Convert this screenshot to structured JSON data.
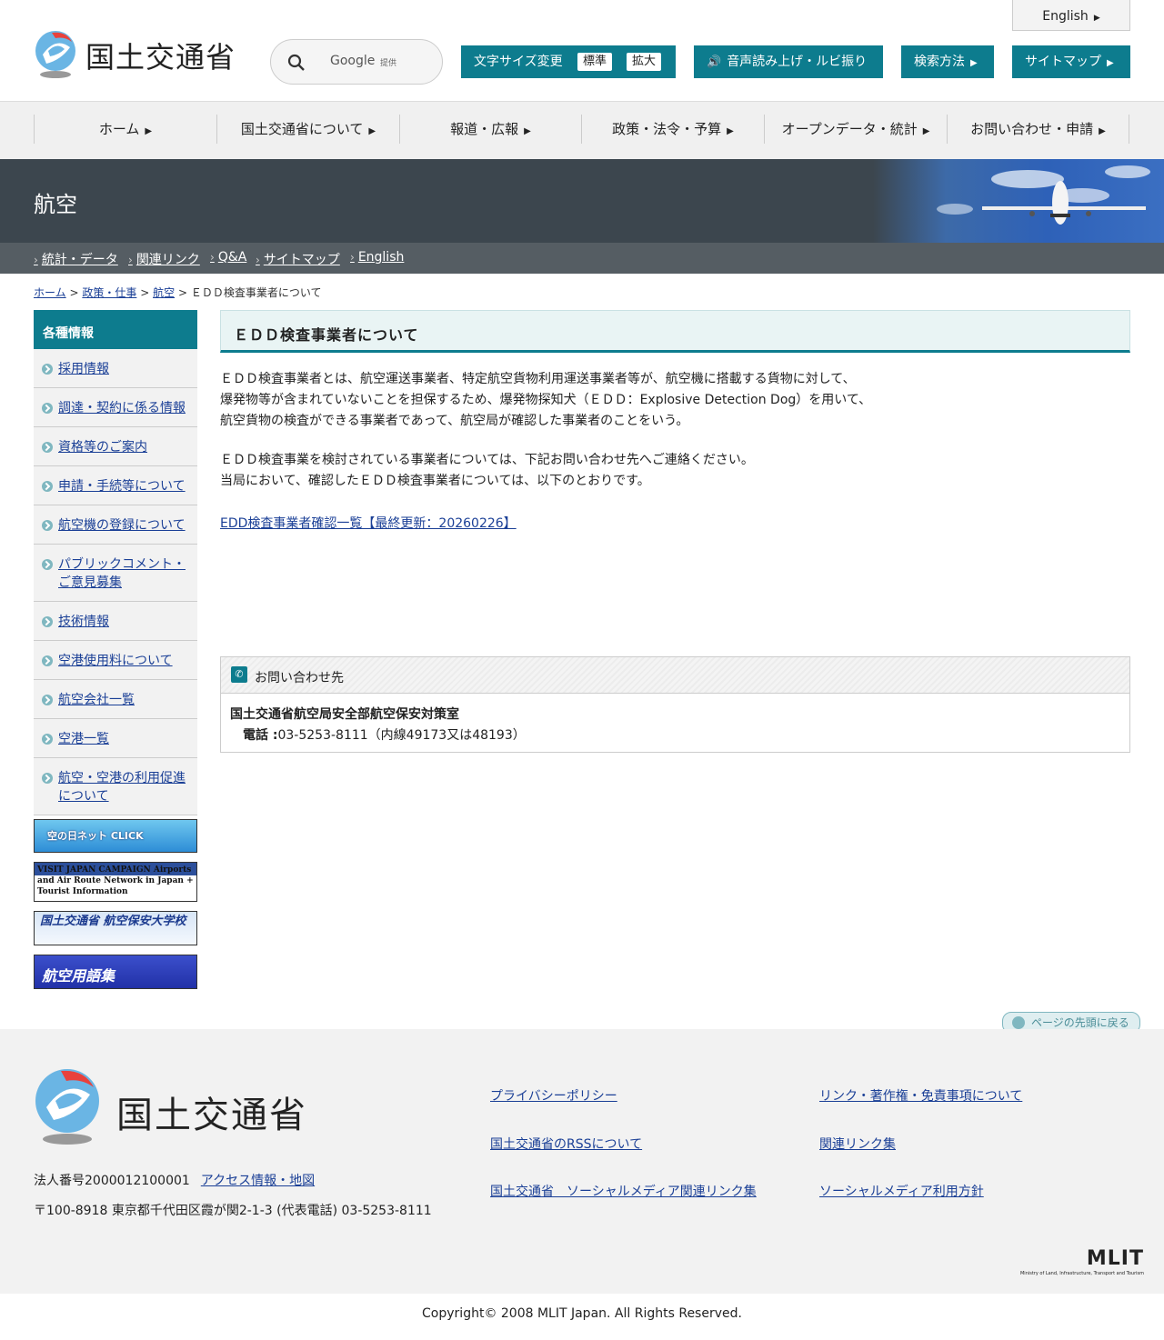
{
  "header": {
    "logo_text": "国土交通省",
    "search_label": "Google",
    "search_provider": "提供",
    "english_tab": "English",
    "fontsize_label": "文字サイズ変更",
    "fontsize_standard": "標準",
    "fontsize_large": "拡大",
    "voice_label": "音声読み上げ・ルビ振り",
    "howto_label": "検索方法",
    "sitemap_label": "サイトマップ"
  },
  "gnav": [
    "ホーム",
    "国土交通省について",
    "報道・広報",
    "政策・法令・予算",
    "オープンデータ・統計",
    "お問い合わせ・申請"
  ],
  "banner": {
    "title": "航空"
  },
  "subnav": [
    "統計・データ",
    "関連リンク",
    "Q&A",
    "サイトマップ",
    "English"
  ],
  "breadcrumb": {
    "home": "ホーム",
    "sep": ">",
    "policy": "政策・仕事",
    "aviation": "航空",
    "current": "ＥＤＤ検査事業者について"
  },
  "sidebar": {
    "heading": "各種情報",
    "items": [
      "採用情報",
      "調達・契約に係る情報",
      "資格等のご案内",
      "申請・手続等について",
      "航空機の登録について",
      "パブリックコメント・ご意見募集",
      "技術情報",
      "空港使用料について",
      "航空会社一覧",
      "空港一覧",
      "航空・空港の利用促進について"
    ],
    "banners": [
      "空の日ネット CLICK",
      "VISIT JAPAN CAMPAIGN Airports and Air Route Network in Japan + Tourist Information",
      "国土交通省 航空保安大学校",
      "航空用語集"
    ]
  },
  "main": {
    "title": "ＥＤＤ検査事業者について",
    "para1_line1": "ＥＤＤ検査事業者とは、航空運送事業者、特定航空貨物利用運送事業者等が、航空機に搭載する貨物に対して、",
    "para1_line2": "爆発物等が含まれていないことを担保するため、爆発物探知犬（ＥＤＤ：Explosive Detection Dog）を用いて、",
    "para1_line3": "航空貨物の検査ができる事業者であって、航空局が確認した事業者のことをいう。",
    "para2_line1": "ＥＤＤ検査事業を検討されている事業者については、下記お問い合わせ先へご連絡ください。",
    "para2_line2": "当局において、確認したＥＤＤ検査事業者については、以下のとおりです。",
    "edd_link": "EDD検査事業者確認一覧【最終更新：20260226】",
    "contact_heading": "お問い合わせ先",
    "contact_org": "国土交通省航空局安全部航空保安対策室",
    "contact_tel_label": "電話 :",
    "contact_tel": "03-5253-8111（内線49173又は48193）"
  },
  "pagetop": "ページの先頭に戻る",
  "footer": {
    "logo_text": "国土交通省",
    "corp_number": "法人番号2000012100001",
    "access": "アクセス情報・地図",
    "address": "〒100-8918 東京都千代田区霞が関2-1-3 (代表電話) 03-5253-8111",
    "links": [
      "プライバシーポリシー",
      "リンク・著作権・免責事項について",
      "国土交通省のRSSについて",
      "関連リンク集",
      "国土交通省　ソーシャルメディア関連リンク集",
      "ソーシャルメディア利用方針"
    ],
    "mlit": "MLIT",
    "mlit_sub": "Ministry of Land, Infrastructure, Transport and Tourism",
    "copyright": "Copyright© 2008 MLIT Japan. All Rights Reserved."
  },
  "colors": {
    "accent": "#0d7c8e",
    "banner": "#3c464e",
    "subnav": "#555d63",
    "link": "#1a3f96"
  }
}
